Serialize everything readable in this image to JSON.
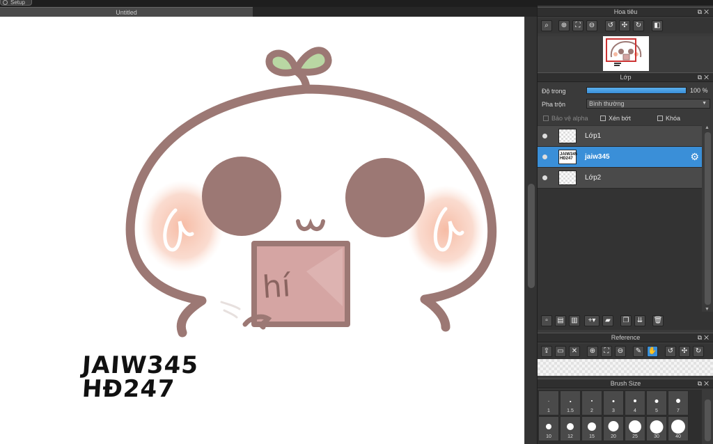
{
  "app": {
    "setup_label": "Setup",
    "document_tab": "Untitled"
  },
  "canvas": {
    "sticker_text": "hí",
    "caption_line1": "JAIW345",
    "caption_line2": "HĐ247"
  },
  "navigator": {
    "title": "Hoa tiêu",
    "tools": [
      "zoom-fit-icon",
      "zoom-in-icon",
      "fit-window-icon",
      "zoom-out-icon",
      "rotate-left-icon",
      "actual-size-icon",
      "rotate-right-icon",
      "flip-icon"
    ]
  },
  "layers": {
    "title": "Lớp",
    "opacity_label": "Độ trong",
    "opacity_value": "100 %",
    "opacity_fraction": 1.0,
    "blend_label": "Pha trộn",
    "blend_value": "Bình thường",
    "protect_alpha_label": "Bảo vệ alpha",
    "clipping_label": "Xén bớt",
    "lock_label": "Khóa",
    "items": [
      {
        "name": "Lớp1",
        "selected": false
      },
      {
        "name": "jaiw345",
        "selected": true,
        "thumb_text": "JAIW345 HĐ247"
      },
      {
        "name": "Lớp2",
        "selected": false
      }
    ]
  },
  "reference": {
    "title": "Reference"
  },
  "brush_size": {
    "title": "Brush Size",
    "sizes": [
      "1",
      "1.5",
      "2",
      "3",
      "4",
      "5",
      "7",
      "10",
      "12",
      "15",
      "20",
      "25",
      "30",
      "40"
    ]
  },
  "colors": {
    "accent": "#3a8fd8",
    "panel_bg": "#3a3a3a",
    "drawing_outline": "#9c7874",
    "leaf": "#b9d7a3",
    "blush": "#f6b8a0",
    "sign_fill": "#d5a5a3"
  }
}
